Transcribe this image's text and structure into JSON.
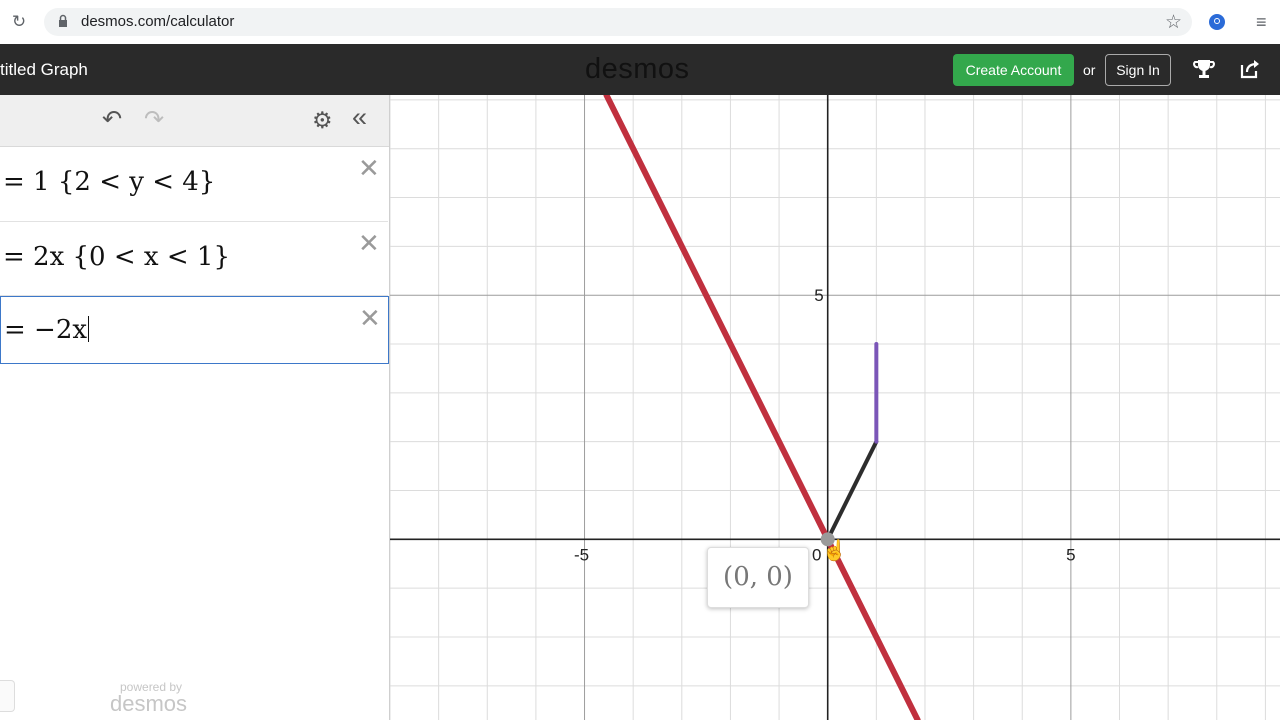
{
  "browser": {
    "url": "desmos.com/calculator"
  },
  "header": {
    "title": "titled Graph",
    "logo": "desmos",
    "create_account": "Create Account",
    "or": "or",
    "sign_in": "Sign In"
  },
  "expressions": [
    {
      "latex_text": "= 1 {2 < y < 4}",
      "color": "#7b56b8"
    },
    {
      "latex_text": "= 2x {0 < x < 1}",
      "color": "#2d2d2d"
    },
    {
      "latex_text": "= −2x",
      "color": "#c0303e"
    }
  ],
  "panel": {
    "powered_by": "powered by",
    "powered_logo": "desmos"
  },
  "graph": {
    "x_range": [
      -9.0,
      9.3
    ],
    "y_range": [
      -3.7,
      9.1
    ],
    "axis_labels": {
      "x_neg5": "-5",
      "x_0": "0",
      "x_5": "5",
      "y_5": "5"
    },
    "tooltip": "(0, 0)",
    "colors": {
      "red": "#c0303e",
      "dark": "#2d2d2d",
      "purple": "#7b56b8"
    }
  }
}
